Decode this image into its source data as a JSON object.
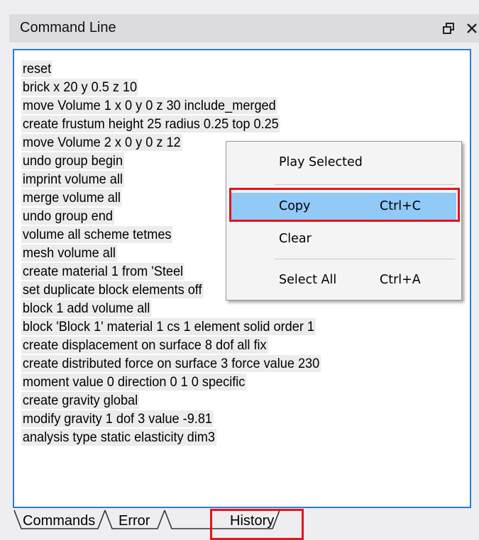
{
  "panel": {
    "title": "Command Line",
    "float_icon": "float-window-icon",
    "close_icon": "close-icon"
  },
  "history": {
    "lines": [
      "reset",
      "brick x 20 y 0.5 z 10",
      "move Volume 1  x 0 y 0 z 30 include_merged",
      "create frustum height 25 radius 0.25 top 0.25",
      "move Volume 2 x 0 y 0 z 12",
      "undo group begin",
      "imprint volume all",
      "merge volume all",
      "undo group end",
      "volume all scheme tetmes",
      "mesh volume all",
      "create material 1 from 'Steel",
      "set duplicate block elements off",
      "block 1 add volume all",
      "block 'Block 1' material 1 cs 1 element solid order 1",
      "create displacement  on surface 8  dof all fix",
      "create distributed force on surface 3  force value 230",
      "moment value 0 direction 0 1 0 specific",
      "create gravity global",
      "modify gravity 1 dof 3 value -9.81",
      "analysis type static elasticity dim3"
    ]
  },
  "tabs": [
    {
      "label": "Commands"
    },
    {
      "label": "Error"
    },
    {
      "label": "History"
    }
  ],
  "active_tab": "History",
  "context_menu": {
    "items": [
      {
        "label": "Play Selected",
        "shortcut": ""
      },
      {
        "label": "Copy",
        "shortcut": "Ctrl+C"
      },
      {
        "label": "Clear",
        "shortcut": ""
      },
      {
        "label": "Select All",
        "shortcut": "Ctrl+A"
      }
    ],
    "highlighted": "Copy"
  },
  "colors": {
    "selection_border": "#2b7dd2",
    "callout_red": "#e3141b",
    "menu_hover": "#91c9f7",
    "line_highlight": "#ececec"
  }
}
